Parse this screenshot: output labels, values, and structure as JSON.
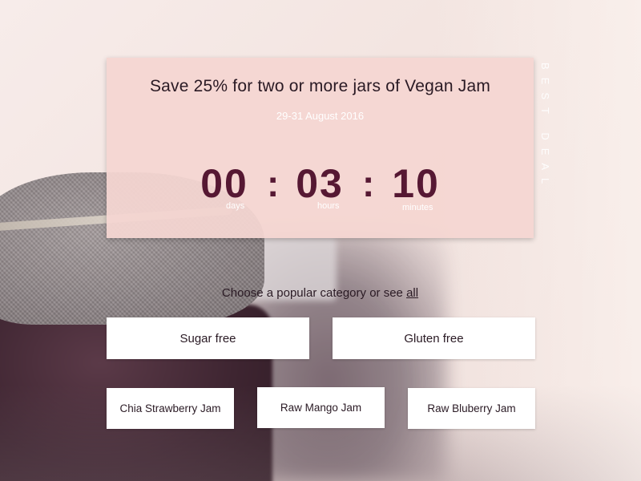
{
  "promo": {
    "title": "Save 25% for two or more jars of Vegan Jam",
    "dates": "29-31 August 2016",
    "countdown": {
      "days": "00",
      "days_label": "days",
      "hours": "03",
      "hours_label": "hours",
      "minutes": "10",
      "minutes_label": "minutes",
      "separator": ":"
    },
    "side_label": "BEST DEAL"
  },
  "categories": {
    "prompt": "Choose a popular category or see ",
    "all_link": "all",
    "primary": [
      "Sugar free",
      "Gluten free"
    ],
    "secondary": [
      "Chia Strawberry Jam",
      "Raw Mango Jam",
      "Raw Bluberry Jam"
    ]
  },
  "colors": {
    "accent": "#561833",
    "card_bg": "#f4d6d1",
    "button_bg": "#ffffff",
    "text": "#2a1a24"
  }
}
